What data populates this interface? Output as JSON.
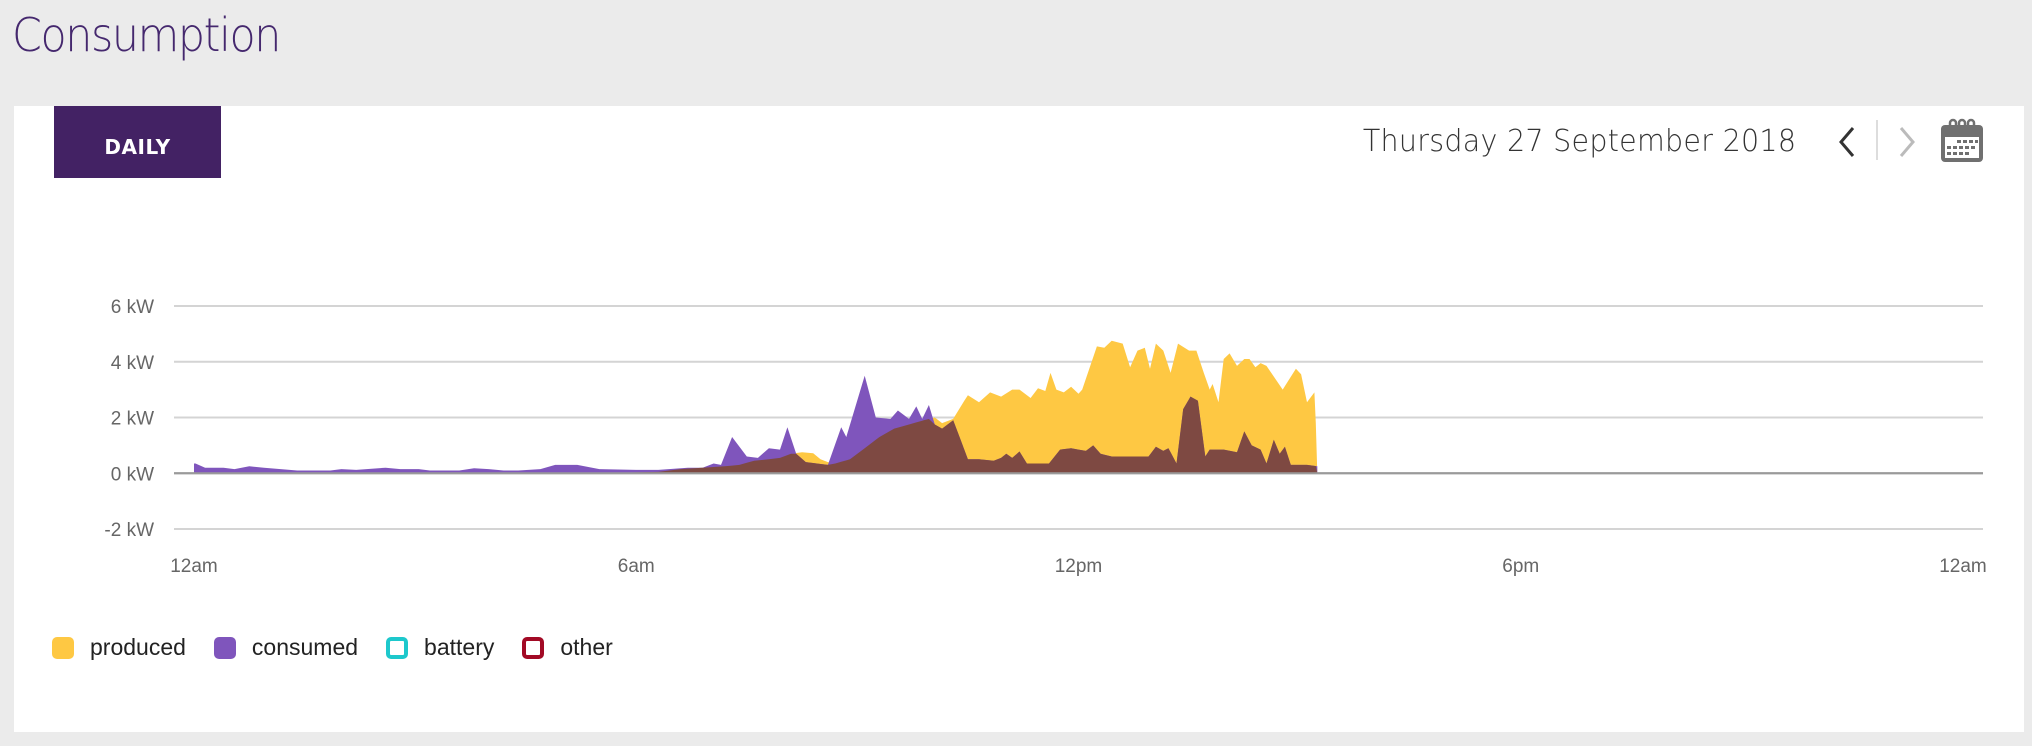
{
  "page": {
    "title": "Consumption"
  },
  "toolbar": {
    "period_button": "DAILY",
    "date": "Thursday 27 September 2018",
    "prev_icon": "chevron-left-icon",
    "next_icon": "chevron-right-icon",
    "calendar_icon": "calendar-icon"
  },
  "colors": {
    "produced": "#fec843",
    "consumed": "#7f55bc",
    "self_consumed": "#7e4942",
    "battery": "#1dc8cc",
    "other": "#a20a25",
    "accent": "#432264",
    "title": "#45286e"
  },
  "chart_data": {
    "type": "area",
    "title": "",
    "xlabel": "",
    "ylabel": "",
    "x_unit": "hour of day",
    "xlim": [
      0,
      24
    ],
    "ylim": [
      -2,
      6
    ],
    "x_ticks": [
      {
        "value": 0,
        "label": "12am"
      },
      {
        "value": 6,
        "label": "6am"
      },
      {
        "value": 12,
        "label": "12pm"
      },
      {
        "value": 18,
        "label": "6pm"
      },
      {
        "value": 24,
        "label": "12am"
      }
    ],
    "y_ticks": [
      {
        "value": 6,
        "label": "6 kW"
      },
      {
        "value": 4,
        "label": "4 kW"
      },
      {
        "value": 2,
        "label": "2 kW"
      },
      {
        "value": 0,
        "label": "0 kW"
      },
      {
        "value": -2,
        "label": "-2 kW"
      }
    ],
    "grid": true,
    "legend_position": "bottom-left",
    "overlap_note": "dark brown area = min(produced, consumed)",
    "series": [
      {
        "name": "produced",
        "x": [
          0.0,
          5.5,
          6.3,
          6.6,
          6.9,
          7.2,
          7.4,
          7.6,
          7.8,
          7.95,
          8.1,
          8.25,
          8.4,
          8.5,
          8.6,
          8.7,
          8.9,
          9.1,
          9.3,
          9.5,
          9.7,
          9.9,
          10.05,
          10.15,
          10.3,
          10.45,
          10.5,
          10.65,
          10.8,
          10.95,
          11.1,
          11.2,
          11.35,
          11.45,
          11.55,
          11.62,
          11.7,
          11.8,
          11.9,
          12.0,
          12.05,
          12.25,
          12.35,
          12.45,
          12.6,
          12.7,
          12.8,
          12.9,
          12.97,
          13.05,
          13.15,
          13.25,
          13.35,
          13.5,
          13.6,
          13.7,
          13.78,
          13.82,
          13.9,
          13.97,
          14.05,
          14.15,
          14.25,
          14.32,
          14.4,
          14.47,
          14.55,
          14.77,
          14.95,
          15.02,
          15.1,
          15.2,
          15.22,
          15.24
        ],
        "values": [
          0.0,
          0.0,
          0.05,
          0.15,
          0.2,
          0.25,
          0.3,
          0.45,
          0.5,
          0.55,
          0.7,
          0.75,
          0.72,
          0.5,
          0.4,
          0.35,
          0.5,
          0.9,
          1.3,
          1.6,
          1.75,
          1.9,
          2.0,
          1.8,
          1.95,
          2.6,
          2.8,
          2.55,
          2.9,
          2.75,
          3.0,
          3.0,
          2.7,
          3.05,
          2.95,
          3.6,
          3.0,
          2.9,
          3.1,
          2.85,
          3.0,
          4.55,
          4.5,
          4.75,
          4.65,
          3.8,
          4.4,
          4.5,
          3.75,
          4.65,
          4.4,
          3.6,
          4.65,
          4.4,
          4.4,
          3.6,
          3.0,
          3.2,
          2.55,
          4.1,
          4.3,
          3.85,
          4.1,
          4.1,
          3.8,
          3.95,
          3.85,
          3.0,
          3.75,
          3.55,
          2.55,
          2.9,
          1.8,
          0.0
        ]
      },
      {
        "name": "consumed",
        "x": [
          0.0,
          0.02,
          0.15,
          0.4,
          0.55,
          0.75,
          0.95,
          1.4,
          1.6,
          1.85,
          2.0,
          2.2,
          2.6,
          2.8,
          3.05,
          3.2,
          3.6,
          3.8,
          4.0,
          4.2,
          4.4,
          4.7,
          4.9,
          5.2,
          5.5,
          6.0,
          6.3,
          6.7,
          6.9,
          7.05,
          7.15,
          7.3,
          7.5,
          7.65,
          7.8,
          7.95,
          8.05,
          8.17,
          8.3,
          8.45,
          8.6,
          8.78,
          8.85,
          9.1,
          9.25,
          9.45,
          9.55,
          9.7,
          9.8,
          9.88,
          9.97,
          10.05,
          10.15,
          10.3,
          10.4,
          10.5,
          10.65,
          10.85,
          10.95,
          11.02,
          11.1,
          11.2,
          11.3,
          11.6,
          11.75,
          11.9,
          12.0,
          12.1,
          12.2,
          12.3,
          12.45,
          12.55,
          12.65,
          12.8,
          12.95,
          13.05,
          13.15,
          13.22,
          13.33,
          13.42,
          13.52,
          13.62,
          13.72,
          13.78,
          13.87,
          13.97,
          14.15,
          14.25,
          14.35,
          14.47,
          14.55,
          14.65,
          14.73,
          14.8,
          14.88,
          14.98,
          15.1,
          15.24
        ],
        "values": [
          0.35,
          0.35,
          0.2,
          0.2,
          0.15,
          0.25,
          0.2,
          0.1,
          0.1,
          0.1,
          0.15,
          0.12,
          0.2,
          0.15,
          0.15,
          0.1,
          0.1,
          0.18,
          0.15,
          0.1,
          0.1,
          0.15,
          0.3,
          0.3,
          0.15,
          0.12,
          0.12,
          0.2,
          0.2,
          0.35,
          0.3,
          1.3,
          0.6,
          0.55,
          0.9,
          0.85,
          1.65,
          0.7,
          0.4,
          0.35,
          0.3,
          1.65,
          1.3,
          3.5,
          2.0,
          1.95,
          2.25,
          1.95,
          2.4,
          1.95,
          2.45,
          1.75,
          1.6,
          1.9,
          1.2,
          0.5,
          0.5,
          0.45,
          0.55,
          0.7,
          0.55,
          0.78,
          0.35,
          0.35,
          0.85,
          0.9,
          0.85,
          0.8,
          1.0,
          0.7,
          0.6,
          0.6,
          0.6,
          0.6,
          0.6,
          0.95,
          0.8,
          0.9,
          0.35,
          2.3,
          2.75,
          2.6,
          0.6,
          0.85,
          0.85,
          0.85,
          0.75,
          1.5,
          1.0,
          0.85,
          0.35,
          1.2,
          0.7,
          0.95,
          0.3,
          0.3,
          0.3,
          0.25
        ]
      },
      {
        "name": "battery",
        "x": [],
        "values": []
      },
      {
        "name": "other",
        "x": [],
        "values": []
      }
    ],
    "legend": [
      {
        "name": "produced",
        "style": "filled"
      },
      {
        "name": "consumed",
        "style": "filled"
      },
      {
        "name": "battery",
        "style": "outline"
      },
      {
        "name": "other",
        "style": "outline"
      }
    ]
  }
}
